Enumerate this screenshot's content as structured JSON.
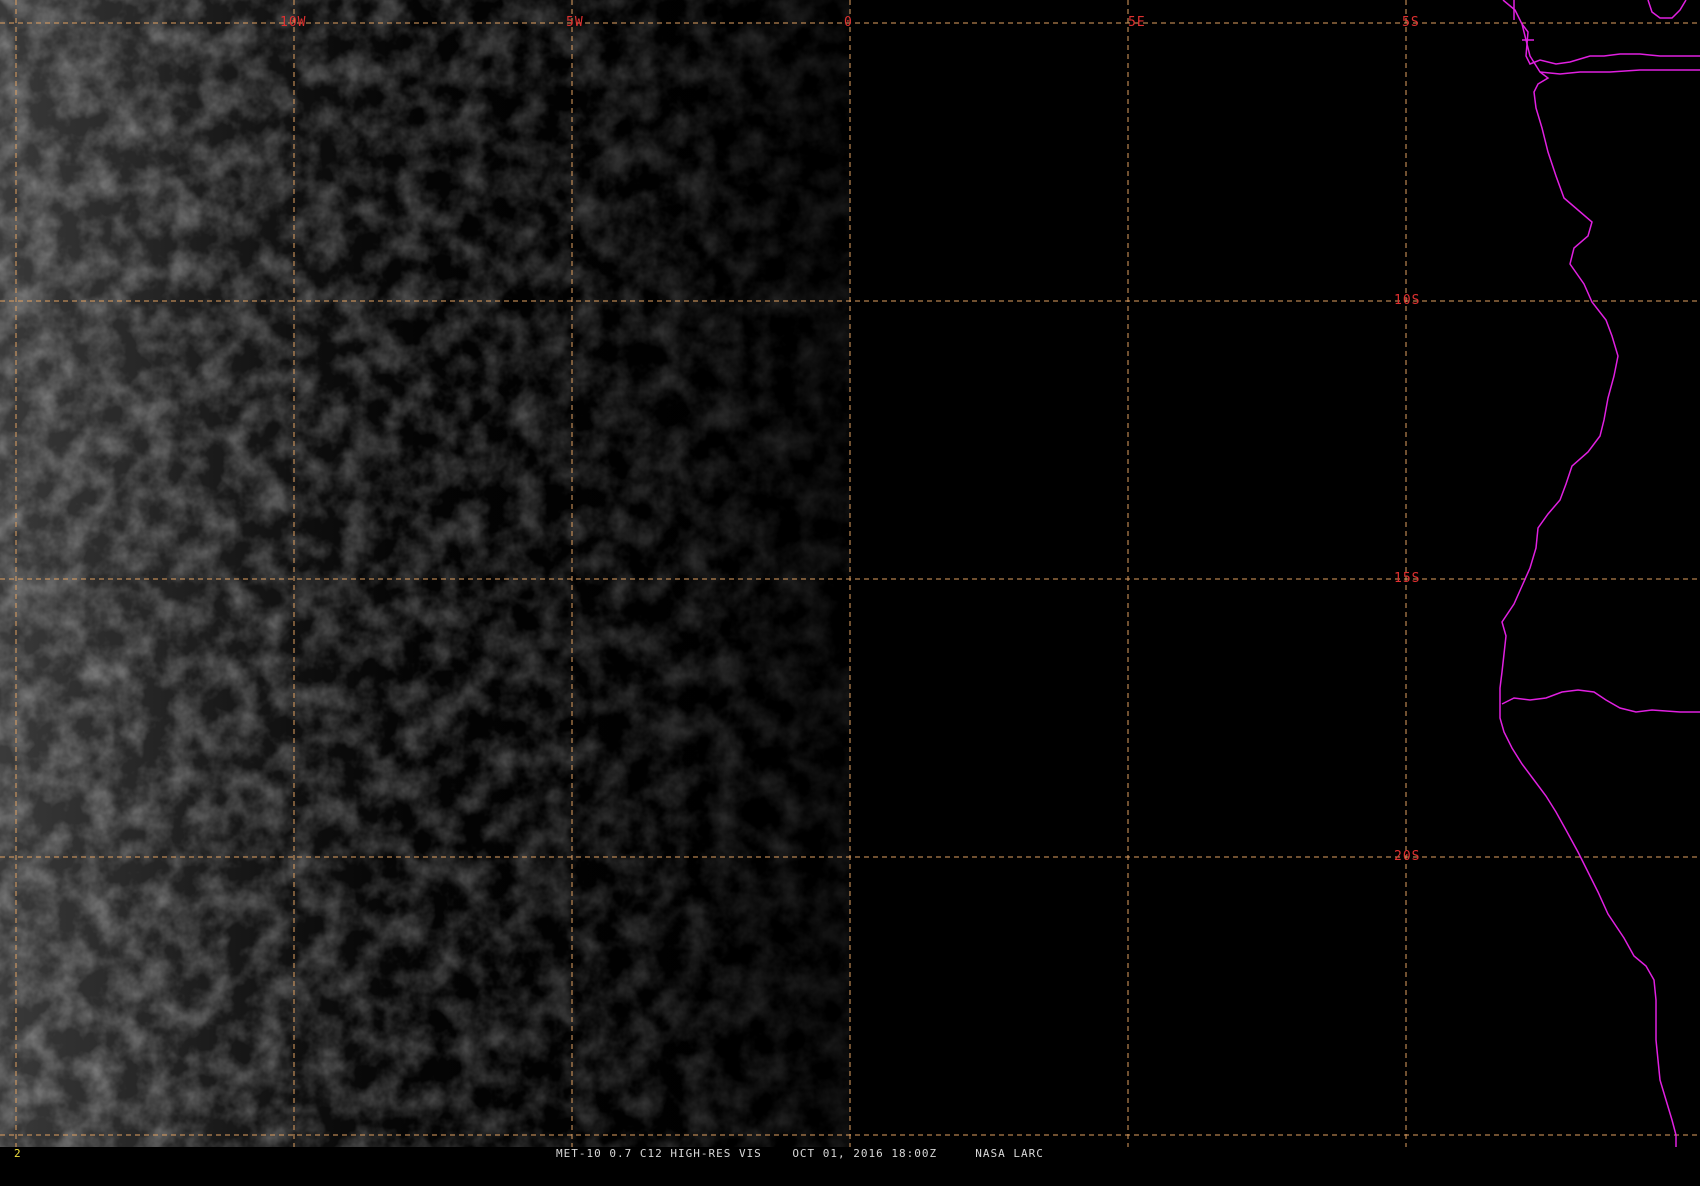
{
  "map": {
    "frame_number": "2",
    "caption": {
      "product": "MET-10 0.7 C12 HIGH-RES VIS",
      "datetime": "OCT 01, 2016 18:00Z",
      "source": "NASA LARC"
    },
    "graticule": {
      "longitude_labels": [
        "10W",
        "5W",
        "0",
        "5E"
      ],
      "latitude_labels": [
        "5S",
        "10S",
        "15S",
        "20S"
      ],
      "line_color": "#e0a060",
      "label_color": "#e03030"
    },
    "boundary_color": "#e020e0",
    "background_color": "#000000"
  }
}
